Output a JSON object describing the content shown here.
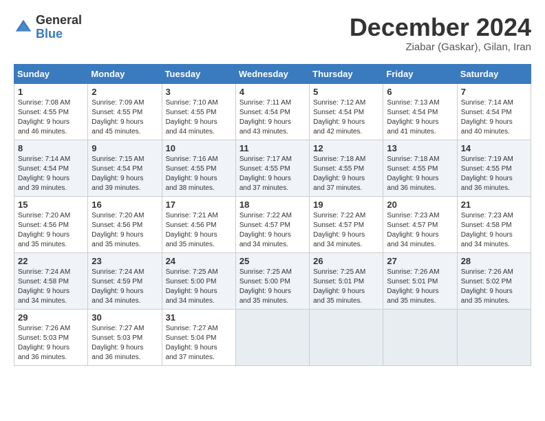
{
  "header": {
    "logo_general": "General",
    "logo_blue": "Blue",
    "month_title": "December 2024",
    "subtitle": "Ziabar (Gaskar), Gilan, Iran"
  },
  "weekdays": [
    "Sunday",
    "Monday",
    "Tuesday",
    "Wednesday",
    "Thursday",
    "Friday",
    "Saturday"
  ],
  "weeks": [
    [
      {
        "day": "1",
        "info": "Sunrise: 7:08 AM\nSunset: 4:55 PM\nDaylight: 9 hours\nand 46 minutes."
      },
      {
        "day": "2",
        "info": "Sunrise: 7:09 AM\nSunset: 4:55 PM\nDaylight: 9 hours\nand 45 minutes."
      },
      {
        "day": "3",
        "info": "Sunrise: 7:10 AM\nSunset: 4:55 PM\nDaylight: 9 hours\nand 44 minutes."
      },
      {
        "day": "4",
        "info": "Sunrise: 7:11 AM\nSunset: 4:54 PM\nDaylight: 9 hours\nand 43 minutes."
      },
      {
        "day": "5",
        "info": "Sunrise: 7:12 AM\nSunset: 4:54 PM\nDaylight: 9 hours\nand 42 minutes."
      },
      {
        "day": "6",
        "info": "Sunrise: 7:13 AM\nSunset: 4:54 PM\nDaylight: 9 hours\nand 41 minutes."
      },
      {
        "day": "7",
        "info": "Sunrise: 7:14 AM\nSunset: 4:54 PM\nDaylight: 9 hours\nand 40 minutes."
      }
    ],
    [
      {
        "day": "8",
        "info": "Sunrise: 7:14 AM\nSunset: 4:54 PM\nDaylight: 9 hours\nand 39 minutes."
      },
      {
        "day": "9",
        "info": "Sunrise: 7:15 AM\nSunset: 4:54 PM\nDaylight: 9 hours\nand 39 minutes."
      },
      {
        "day": "10",
        "info": "Sunrise: 7:16 AM\nSunset: 4:55 PM\nDaylight: 9 hours\nand 38 minutes."
      },
      {
        "day": "11",
        "info": "Sunrise: 7:17 AM\nSunset: 4:55 PM\nDaylight: 9 hours\nand 37 minutes."
      },
      {
        "day": "12",
        "info": "Sunrise: 7:18 AM\nSunset: 4:55 PM\nDaylight: 9 hours\nand 37 minutes."
      },
      {
        "day": "13",
        "info": "Sunrise: 7:18 AM\nSunset: 4:55 PM\nDaylight: 9 hours\nand 36 minutes."
      },
      {
        "day": "14",
        "info": "Sunrise: 7:19 AM\nSunset: 4:55 PM\nDaylight: 9 hours\nand 36 minutes."
      }
    ],
    [
      {
        "day": "15",
        "info": "Sunrise: 7:20 AM\nSunset: 4:56 PM\nDaylight: 9 hours\nand 35 minutes."
      },
      {
        "day": "16",
        "info": "Sunrise: 7:20 AM\nSunset: 4:56 PM\nDaylight: 9 hours\nand 35 minutes."
      },
      {
        "day": "17",
        "info": "Sunrise: 7:21 AM\nSunset: 4:56 PM\nDaylight: 9 hours\nand 35 minutes."
      },
      {
        "day": "18",
        "info": "Sunrise: 7:22 AM\nSunset: 4:57 PM\nDaylight: 9 hours\nand 34 minutes."
      },
      {
        "day": "19",
        "info": "Sunrise: 7:22 AM\nSunset: 4:57 PM\nDaylight: 9 hours\nand 34 minutes."
      },
      {
        "day": "20",
        "info": "Sunrise: 7:23 AM\nSunset: 4:57 PM\nDaylight: 9 hours\nand 34 minutes."
      },
      {
        "day": "21",
        "info": "Sunrise: 7:23 AM\nSunset: 4:58 PM\nDaylight: 9 hours\nand 34 minutes."
      }
    ],
    [
      {
        "day": "22",
        "info": "Sunrise: 7:24 AM\nSunset: 4:58 PM\nDaylight: 9 hours\nand 34 minutes."
      },
      {
        "day": "23",
        "info": "Sunrise: 7:24 AM\nSunset: 4:59 PM\nDaylight: 9 hours\nand 34 minutes."
      },
      {
        "day": "24",
        "info": "Sunrise: 7:25 AM\nSunset: 5:00 PM\nDaylight: 9 hours\nand 34 minutes."
      },
      {
        "day": "25",
        "info": "Sunrise: 7:25 AM\nSunset: 5:00 PM\nDaylight: 9 hours\nand 35 minutes."
      },
      {
        "day": "26",
        "info": "Sunrise: 7:25 AM\nSunset: 5:01 PM\nDaylight: 9 hours\nand 35 minutes."
      },
      {
        "day": "27",
        "info": "Sunrise: 7:26 AM\nSunset: 5:01 PM\nDaylight: 9 hours\nand 35 minutes."
      },
      {
        "day": "28",
        "info": "Sunrise: 7:26 AM\nSunset: 5:02 PM\nDaylight: 9 hours\nand 35 minutes."
      }
    ],
    [
      {
        "day": "29",
        "info": "Sunrise: 7:26 AM\nSunset: 5:03 PM\nDaylight: 9 hours\nand 36 minutes."
      },
      {
        "day": "30",
        "info": "Sunrise: 7:27 AM\nSunset: 5:03 PM\nDaylight: 9 hours\nand 36 minutes."
      },
      {
        "day": "31",
        "info": "Sunrise: 7:27 AM\nSunset: 5:04 PM\nDaylight: 9 hours\nand 37 minutes."
      },
      null,
      null,
      null,
      null
    ]
  ]
}
